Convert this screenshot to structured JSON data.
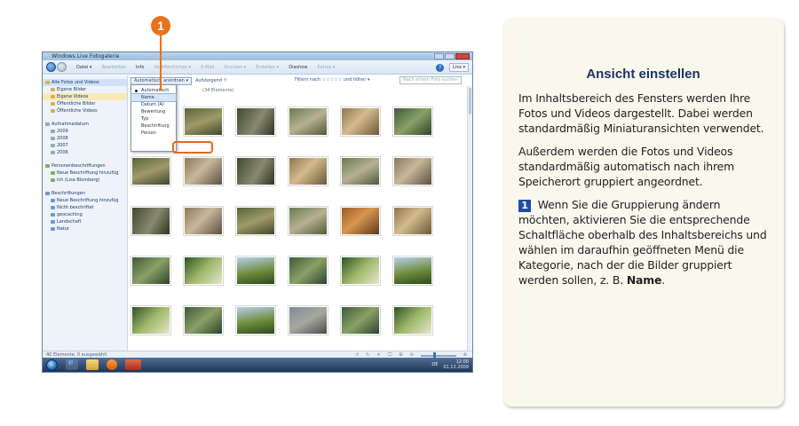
{
  "window": {
    "title": "Windows Live Fotogalerie",
    "menu": [
      {
        "label": "Datei ▾",
        "dim": false
      },
      {
        "label": "Bearbeiten",
        "dim": true
      },
      {
        "label": "Info",
        "dim": false
      },
      {
        "label": "Veröffentlichen ▾",
        "dim": true
      },
      {
        "label": "E-Mail",
        "dim": true
      },
      {
        "label": "Drucken ▾",
        "dim": true
      },
      {
        "label": "Erstellen ▾",
        "dim": true
      },
      {
        "label": "Diashow",
        "dim": false
      },
      {
        "label": "Extras ▾",
        "dim": true
      }
    ],
    "user_label": "Lisa ▾",
    "nav": [
      {
        "label": "Alle Fotos und Videos",
        "level": 0,
        "state": "sel",
        "icon": "folder-icon"
      },
      {
        "label": "Eigene Bilder",
        "level": 1,
        "state": "",
        "icon": "folder-icon"
      },
      {
        "label": "Eigene Videos",
        "level": 1,
        "state": "hi",
        "icon": "folder-icon"
      },
      {
        "label": "Öffentliche Bilder",
        "level": 1,
        "state": "",
        "icon": "folder-icon"
      },
      {
        "label": "Öffentliche Videos",
        "level": 1,
        "state": "",
        "icon": "folder-icon"
      },
      {
        "gap": true
      },
      {
        "label": "Aufnahmedatum",
        "level": 0,
        "state": "",
        "icon": "calendar-icon"
      },
      {
        "label": "2009",
        "level": 1,
        "state": "",
        "icon": "calendar-icon"
      },
      {
        "label": "2008",
        "level": 1,
        "state": "",
        "icon": "calendar-icon"
      },
      {
        "label": "2007",
        "level": 1,
        "state": "",
        "icon": "calendar-icon"
      },
      {
        "label": "2006",
        "level": 1,
        "state": "",
        "icon": "calendar-icon"
      },
      {
        "gap": true
      },
      {
        "label": "Personenbeschriftungen",
        "level": 0,
        "state": "",
        "icon": "people-icon"
      },
      {
        "label": "Neue Beschriftung hinzufüg",
        "level": 1,
        "state": "",
        "icon": "people-icon"
      },
      {
        "label": "Ich (Lisa Blomberg)",
        "level": 1,
        "state": "",
        "icon": "people-icon"
      },
      {
        "gap": true
      },
      {
        "label": "Beschriftungen",
        "level": 0,
        "state": "",
        "icon": "tag-icon"
      },
      {
        "label": "Neue Beschriftung hinzufüg",
        "level": 1,
        "state": "",
        "icon": "tag-icon"
      },
      {
        "label": "Nicht beschriftet",
        "level": 1,
        "state": "",
        "icon": "tag-icon"
      },
      {
        "label": "geocaching",
        "level": 1,
        "state": "",
        "icon": "tag-icon"
      },
      {
        "label": "Landschaft",
        "level": 1,
        "state": "",
        "icon": "tag-icon"
      },
      {
        "label": "Natur",
        "level": 1,
        "state": "",
        "icon": "tag-icon"
      }
    ],
    "sort_button": "Automatisch anordnen ▾",
    "ascending": "Aufsteigend ↑",
    "filter": "Filtern nach ☆☆☆☆☆ und höher ▾",
    "search_placeholder": "Nach einem Foto suchen",
    "item_count": "(34 Elemente)",
    "dropdown": [
      {
        "label": "Automatisch",
        "state": "dot"
      },
      {
        "label": "Name",
        "state": "hov"
      },
      {
        "label": "Datum (A)",
        "state": ""
      },
      {
        "label": "Bewertung",
        "state": ""
      },
      {
        "label": "Typ",
        "state": ""
      },
      {
        "label": "Beschriftung",
        "state": ""
      },
      {
        "label": "Person",
        "state": ""
      }
    ],
    "thumbnails": [
      "t1",
      "t2",
      "t3",
      "t4",
      "t5",
      "t6",
      "t2",
      "t1",
      "t3",
      "t5",
      "t4",
      "t1",
      "t3",
      "t1",
      "t2",
      "t4",
      "t9",
      "t5",
      "t6",
      "t7",
      "t8",
      "t6",
      "t7",
      "t8",
      "t7",
      "t6",
      "t8",
      "t10",
      "t6",
      "t7"
    ],
    "status_text": "40 Elemente, 0 ausgewählt",
    "status_controls": [
      "↺",
      "↻",
      "✕",
      "🖵",
      "⊞",
      "⊖",
      "⊕"
    ],
    "tray_lang": "DE",
    "tray_time": "12:00",
    "tray_date": "01.12.2009"
  },
  "callout_number": "1",
  "panel": {
    "title": "Ansicht einstellen",
    "p1": "Im Inhaltsbereich des Fensters werden Ihre Fotos und Videos dargestellt. Dabei werden standardmäßig Miniaturansichten verwendet.",
    "p2": "Außerdem werden die Fotos und Videos standardmäßig automatisch nach ihrem Speicherort gruppiert angeordnet.",
    "step_number": "1",
    "p3_text": " Wenn Sie die Gruppierung ändern möchten, aktivieren Sie die entspre­chende Schaltfläche oberhalb des Inhaltsbereichs und wählen im daraufhin geöffneten Menü die Kategorie, nach der die Bilder gruppiert werden sollen, z. B. ",
    "p3_bold": "Name",
    "p3_end": "."
  }
}
